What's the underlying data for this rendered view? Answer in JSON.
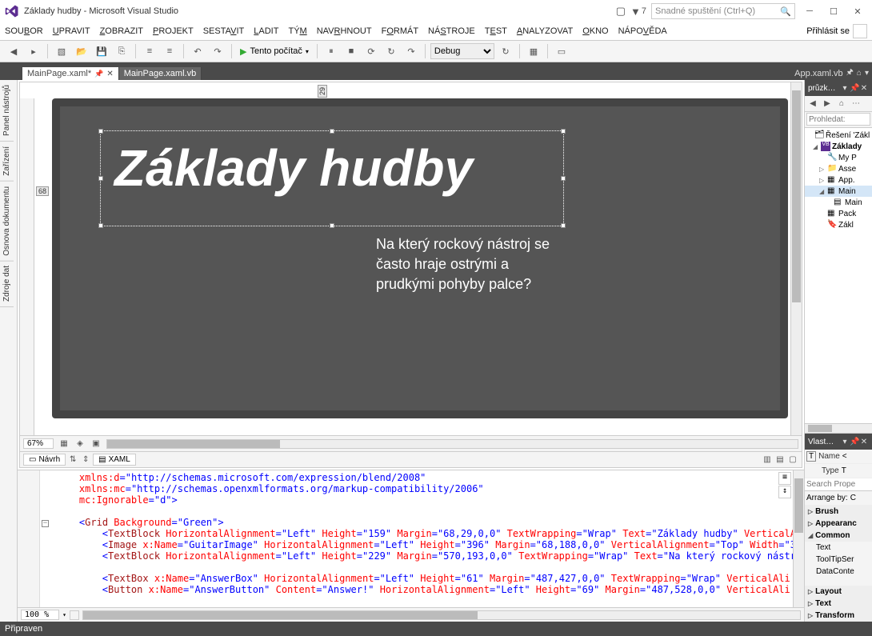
{
  "titlebar": {
    "title": "Základy hudby - Microsoft Visual Studio",
    "notif_count": "7",
    "quicksearch_placeholder": "Snadné spuštění (Ctrl+Q)"
  },
  "menubar": {
    "items": [
      "SOUBOR",
      "UPRAVIT",
      "ZOBRAZIT",
      "PROJEKT",
      "SESTAVIT",
      "LADIT",
      "TÝM",
      "NAVRHNOUT",
      "FORMÁT",
      "NÁSTROJE",
      "TEST",
      "ANALYZOVAT",
      "OKNO",
      "NÁPOVĚDA"
    ],
    "signin": "Přihlásit se"
  },
  "toolbar": {
    "run_target": "Tento počítač",
    "config": "Debug"
  },
  "doctabs": {
    "active": "MainPage.xaml*",
    "other": "MainPage.xaml.vb",
    "right": "App.xaml.vb"
  },
  "leftpanes": [
    "Panel nástrojů",
    "Zařízení",
    "Osnova dokumentu",
    "Zdroje dat"
  ],
  "designer": {
    "title_text": "Základy hudby",
    "sub_text": "Na který rockový nástroj se často hraje ostrými a prudkými pohyby palce?",
    "margin_left": "68",
    "margin_top": "29",
    "zoom": "67%",
    "navrh_tab": "Návrh",
    "xaml_tab": "XAML"
  },
  "xaml": {
    "zoom": "100 %",
    "lines": {
      "l1a": "xmlns:d",
      "l1b": "\"http://schemas.microsoft.com/expression/blend/2008\"",
      "l2a": "xmlns:mc",
      "l2b": "\"http://schemas.openxmlformats.org/markup-compatibility/2006\"",
      "l3a": "mc:Ignorable",
      "l3b": "\"d\"",
      "grid": "Grid",
      "grid_bg_k": "Background",
      "grid_bg_v": "\"Green\"",
      "tb": "TextBlock",
      "img": "Image",
      "tbx": "TextBox",
      "btn": "Button",
      "ha_k": "HorizontalAlignment",
      "ha_v": "\"Left\"",
      "h_k": "Height",
      "h1": "\"159\"",
      "h2": "\"396\"",
      "h3": "\"229\"",
      "h4": "\"61\"",
      "h5": "\"69\"",
      "m_k": "Margin",
      "m1": "\"68,29,0,0\"",
      "m2": "\"68,188,0,0\"",
      "m3": "\"570,193,0,0\"",
      "m4": "\"487,427,0,0\"",
      "m5": "\"487,528,0,0\"",
      "tw_k": "TextWrapping",
      "tw_v": "\"Wrap\"",
      "txt_k": "Text",
      "txt1": "\"Základy hudby\"",
      "txt3": "\"Na který rockový nástr",
      "va_k": "VerticalAlignment",
      "va_v": "\"Top\"",
      "w_k": "Width",
      "xn_k": "x:Name",
      "xn_img": "\"GuitarImage\"",
      "xn_ab": "\"AnswerBox\"",
      "xn_btn": "\"AnswerButton\"",
      "cnt_k": "Content",
      "cnt_v": "\"Answer!\"",
      "vert_tail": "VerticalA",
      "vert_tail2": "VerticalAli",
      "w_tail": "\"3"
    }
  },
  "solution": {
    "title": "průzk…",
    "search_placeholder": "Prohledat: ",
    "root": "Řešení 'Zákl",
    "proj": "Základy",
    "items": [
      "My P",
      "Asse",
      "App.",
      "Main",
      "Main",
      "Pack",
      "Zákl"
    ]
  },
  "props": {
    "title": "Vlast…",
    "name_lbl": "Name",
    "name_val": "<",
    "type_lbl": "Type",
    "type_val": "T",
    "search_placeholder": "Search Prope",
    "arrange": "Arrange by:",
    "arrange_val": "C",
    "cats": {
      "brush": "Brush",
      "appearance": "Appearanc",
      "common": "Common",
      "layout": "Layout",
      "text": "Text",
      "transform": "Transform"
    },
    "common_items": [
      "Text",
      "ToolTipSer",
      "DataConte"
    ]
  },
  "statusbar": {
    "ready": "Připraven"
  }
}
